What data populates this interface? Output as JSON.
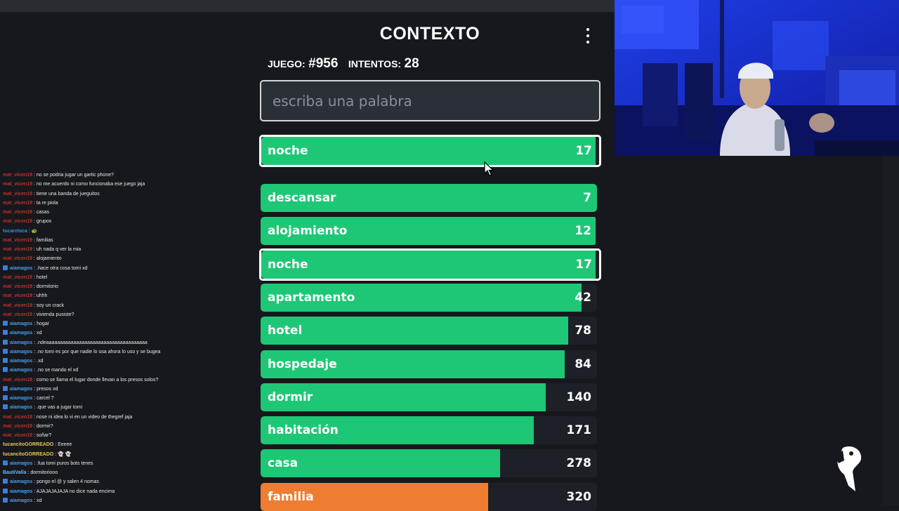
{
  "game": {
    "title": "CONTEXTO",
    "game_label": "JUEGO:",
    "game_number": "#956",
    "attempts_label": "INTENTOS:",
    "attempts": "28",
    "input_placeholder": "escriba una palabra",
    "last_guess": {
      "word": "noche",
      "rank": "17",
      "color": "#1ec776",
      "fill": 0.99
    },
    "guesses": [
      {
        "word": "descansar",
        "rank": "7",
        "color": "#1ec776",
        "fill": 1.0,
        "highlight": false
      },
      {
        "word": "alojamiento",
        "rank": "12",
        "color": "#1ec776",
        "fill": 0.995,
        "highlight": false
      },
      {
        "word": "noche",
        "rank": "17",
        "color": "#1ec776",
        "fill": 0.99,
        "highlight": true
      },
      {
        "word": "apartamento",
        "rank": "42",
        "color": "#1ec776",
        "fill": 0.955,
        "highlight": false
      },
      {
        "word": "hotel",
        "rank": "78",
        "color": "#1ec776",
        "fill": 0.915,
        "highlight": false
      },
      {
        "word": "hospedaje",
        "rank": "84",
        "color": "#1ec776",
        "fill": 0.905,
        "highlight": false
      },
      {
        "word": "dormir",
        "rank": "140",
        "color": "#1ec776",
        "fill": 0.847,
        "highlight": false
      },
      {
        "word": "habitación",
        "rank": "171",
        "color": "#1ec776",
        "fill": 0.813,
        "highlight": false
      },
      {
        "word": "casa",
        "rank": "278",
        "color": "#1ec776",
        "fill": 0.712,
        "highlight": false
      },
      {
        "word": "familia",
        "rank": "320",
        "color": "#ef7d31",
        "fill": 0.677,
        "highlight": false
      }
    ]
  },
  "chat": [
    {
      "user": "mat_vicen19",
      "msg": "no se podria jugar un gartic phone?",
      "color": "#c0312f",
      "badge": false
    },
    {
      "user": "mat_vicen19",
      "msg": "no me acuerdo ni como funcionaba ese juego jaja",
      "color": "#c0312f",
      "badge": false
    },
    {
      "user": "mat_vicen19",
      "msg": "tiene una banda de jueguitos",
      "color": "#c0312f",
      "badge": false
    },
    {
      "user": "mat_vicen19",
      "msg": "ta re piola",
      "color": "#c0312f",
      "badge": false
    },
    {
      "user": "mat_vicen19",
      "msg": "casas",
      "color": "#c0312f",
      "badge": false
    },
    {
      "user": "mat_vicen19",
      "msg": "grupos",
      "color": "#c0312f",
      "badge": false
    },
    {
      "user": "tucareloca",
      "msg": "🐢",
      "color": "#3d8be0",
      "badge": false
    },
    {
      "user": "mat_vicen19",
      "msg": "familias",
      "color": "#c0312f",
      "badge": false
    },
    {
      "user": "mat_vicen19",
      "msg": "uh nada q ver la mia",
      "color": "#c0312f",
      "badge": false
    },
    {
      "user": "mat_vicen19",
      "msg": "alojamiento",
      "color": "#c0312f",
      "badge": false
    },
    {
      "user": "aiamagos",
      "msg": ".hace otra cosa tomi xd",
      "color": "#4a9fe8",
      "badge": true
    },
    {
      "user": "mat_vicen19",
      "msg": "hotel",
      "color": "#c0312f",
      "badge": false
    },
    {
      "user": "mat_vicen19",
      "msg": "dormitorio",
      "color": "#c0312f",
      "badge": false
    },
    {
      "user": "mat_vicen19",
      "msg": "uhhh",
      "color": "#c0312f",
      "badge": false
    },
    {
      "user": "mat_vicen19",
      "msg": "soy un crack",
      "color": "#c0312f",
      "badge": false
    },
    {
      "user": "mat_vicen19",
      "msg": "vivienda pusiste?",
      "color": "#c0312f",
      "badge": false
    },
    {
      "user": "aiamagos",
      "msg": "hogar",
      "color": "#4a9fe8",
      "badge": true
    },
    {
      "user": "aiamagos",
      "msg": "xd",
      "color": "#4a9fe8",
      "badge": true
    },
    {
      "user": "aiamagos",
      "msg": ".ndeaaaaaaaaaaaaaaaaaaaaaaaaaaaaaaaaaaaaa",
      "color": "#4a9fe8",
      "badge": true
    },
    {
      "user": "aiamagos",
      "msg": ".no tomi es por que nadie lo usa ahora lo uso y se bugea",
      "color": "#4a9fe8",
      "badge": true
    },
    {
      "user": "aiamagos",
      "msg": ".xd",
      "color": "#4a9fe8",
      "badge": true
    },
    {
      "user": "aiamagos",
      "msg": ".no se mando el xd",
      "color": "#4a9fe8",
      "badge": true
    },
    {
      "user": "mat_vicen19",
      "msg": "como se llama el lugar donde llevan a los presos solos?",
      "color": "#c0312f",
      "badge": false
    },
    {
      "user": "aiamagos",
      "msg": "presos xd",
      "color": "#4a9fe8",
      "badge": true
    },
    {
      "user": "aiamagos",
      "msg": "carcel ?",
      "color": "#4a9fe8",
      "badge": true
    },
    {
      "user": "aiamagos",
      "msg": ".que vas a jugar tomi",
      "color": "#4a9fe8",
      "badge": true
    },
    {
      "user": "mat_vicen19",
      "msg": "nose ni idea lo vi en un video de thegref jaja",
      "color": "#c0312f",
      "badge": false
    },
    {
      "user": "mat_vicen19",
      "msg": "dormir?",
      "color": "#c0312f",
      "badge": false
    },
    {
      "user": "mat_vicen19",
      "msg": "soñar?",
      "color": "#c0312f",
      "badge": false
    },
    {
      "user": "tucancitoGORREADO",
      "msg": "Eeeee",
      "color": "#e8c75a",
      "badge": false
    },
    {
      "user": "tucancitoGORREADO",
      "msg": "👻 👻",
      "color": "#e8c75a",
      "badge": false
    },
    {
      "user": "aiamagos",
      "msg": ".fua tomi puros bots tenes",
      "color": "#4a9fe8",
      "badge": true
    },
    {
      "user": "BautiValla",
      "msg": "dormitoriooo",
      "color": "#6bb5ff",
      "badge": false
    },
    {
      "user": "aiamagos",
      "msg": "pongo el @ y salen 4 nomas",
      "color": "#4a9fe8",
      "badge": true
    },
    {
      "user": "aiamagos",
      "msg": "AJAJAJAJAJA no dice nada encima",
      "color": "#4a9fe8",
      "badge": true
    },
    {
      "user": "aiamagos",
      "msg": "xd",
      "color": "#4a9fe8",
      "badge": true
    }
  ]
}
